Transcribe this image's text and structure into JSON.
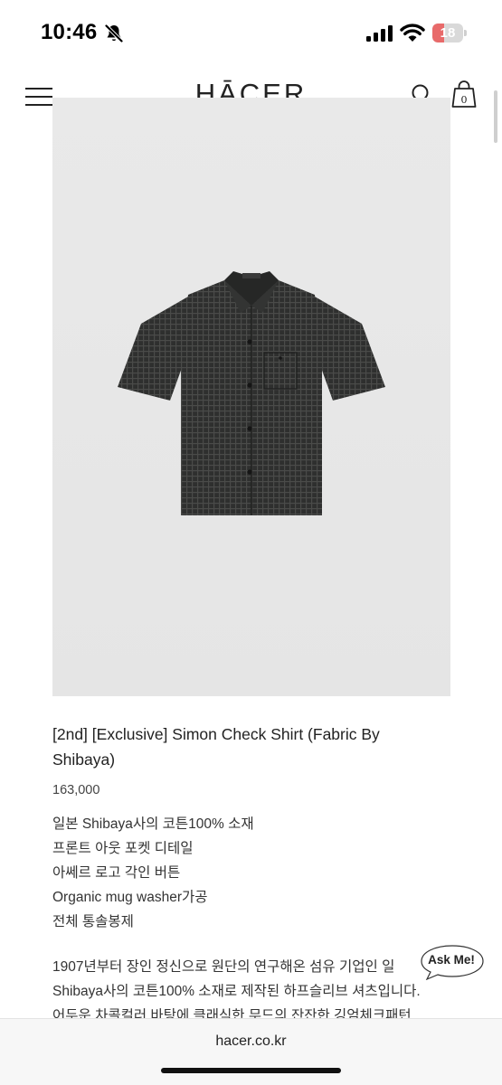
{
  "status_bar": {
    "time": "10:46",
    "battery_level": "18",
    "battery_fraction": 0.18
  },
  "header": {
    "logo": "HĀCER",
    "cart_count": "0",
    "icons": [
      "menu-icon",
      "search-icon",
      "cart-icon"
    ]
  },
  "product": {
    "image_alt": "shirt-photo",
    "title": "[2nd] [Exclusive] Simon Check Shirt (Fabric By Shibaya)",
    "price": "163,000",
    "details": [
      "일본 Shibaya사의 코튼100% 소재",
      "프론트 아웃 포켓 디테일",
      "아쎄르 로고 각인 버튼",
      "Organic mug washer가공",
      "전체 통솔봉제"
    ],
    "description_lines": [
      "1907년부터 장인 정신으로 원단의 연구해온 섬유 기업인 일",
      "Shibaya사의 코튼100% 소재로 제작된 하프슬리브 셔츠입니다.",
      "어두운 차콜컬러 바탕에 클래식한 무드의 잔잔한 깅엄체크패턴"
    ]
  },
  "chat": {
    "label": "Ask Me!"
  },
  "browser": {
    "url": "hacer.co.kr"
  },
  "colors": {
    "battery_low": "#e86a6a",
    "image_bg": "#e8e8e8",
    "shirt": "#2e2f2e"
  }
}
